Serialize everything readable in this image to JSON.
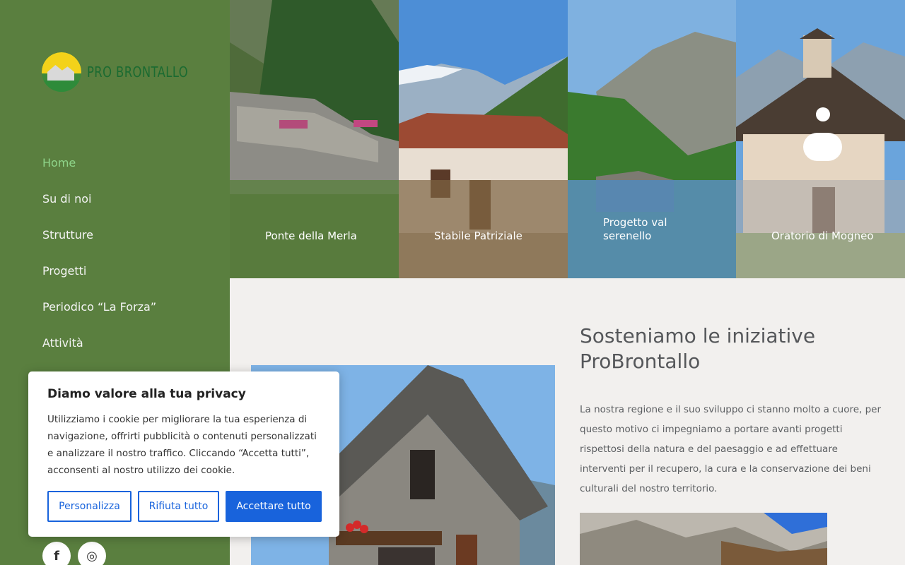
{
  "logo": {
    "text": "PRO BRONTALLO"
  },
  "nav": {
    "items": [
      {
        "label": "Home"
      },
      {
        "label": "Su di noi"
      },
      {
        "label": "Strutture"
      },
      {
        "label": "Progetti"
      },
      {
        "label": "Periodico “La Forza”"
      },
      {
        "label": "Attività"
      }
    ],
    "active": "Home"
  },
  "tiles": [
    {
      "label": "Ponte della Merla"
    },
    {
      "label": "Stabile Patriziale"
    },
    {
      "label": "Progetto val serenello"
    },
    {
      "label": "Oratorio di Mogneo"
    }
  ],
  "main": {
    "heading": "Sosteniamo le iniziative ProBrontallo",
    "body": "La nostra regione e il suo sviluppo ci stanno molto a cuore, per questo motivo ci impegniamo a portare avanti progetti rispettosi della natura e del paesaggio e ad effettuare interventi per il recupero, la cura e la conservazione dei beni culturali del nostro territorio."
  },
  "cookie": {
    "title": "Diamo valore alla tua privacy",
    "text": "Utilizziamo i cookie per migliorare la tua esperienza di navigazione, offrirti pubblicità o contenuti personalizzati e analizzare il nostro traffico. Cliccando “Accetta tutti”, acconsenti al nostro utilizzo dei cookie.",
    "customize_label": "Personalizza",
    "reject_label": "Rifiuta tutto",
    "accept_label": "Accettare tutto"
  },
  "social": [
    {
      "icon": "facebook-icon",
      "glyph": "f"
    },
    {
      "icon": "instagram-icon",
      "glyph": "◎"
    }
  ],
  "colors": {
    "sidebar": "#5a7f3f",
    "nav_active": "#8fd58a",
    "accent": "#1863dc",
    "logo_text": "#1b6b31"
  }
}
